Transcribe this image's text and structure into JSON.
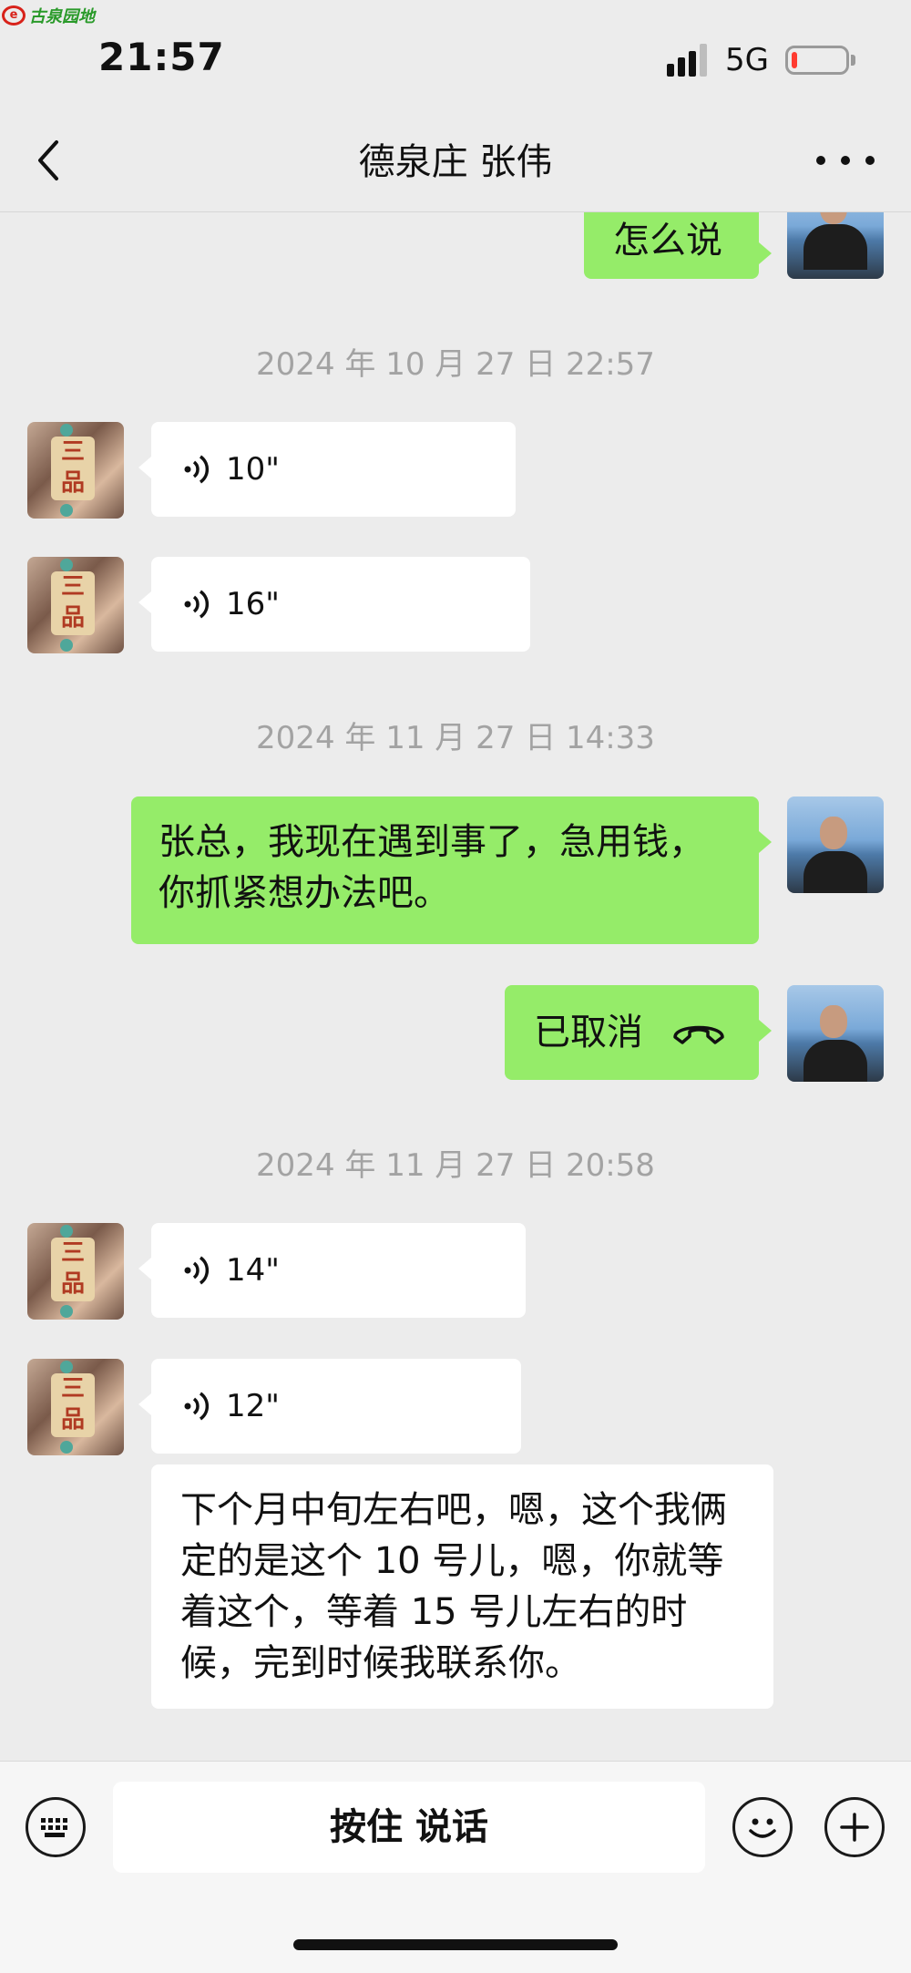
{
  "watermark": {
    "text": "古泉园地"
  },
  "status": {
    "time": "21:57",
    "network": "5G"
  },
  "header": {
    "title": "德泉庄  张伟"
  },
  "messages": {
    "partial_sent": "怎么说",
    "ts1": "2024 年 10 月 27 日 22:57",
    "voice1": "10\"",
    "voice2": "16\"",
    "ts2": "2024 年 11 月 27 日 14:33",
    "sent_text": "张总，我现在遇到事了，急用钱，你抓紧想办法吧。",
    "call": "已取消",
    "ts3": "2024 年 11 月 27 日 20:58",
    "voice3": "14\"",
    "voice4": "12\"",
    "transcript": "下个月中旬左右吧，嗯，这个我俩定的是这个 10 号儿，嗯，你就等着这个，等着 15 号儿左右的时候，完到时候我联系你。"
  },
  "avatars": {
    "other_tile": "三品"
  },
  "input": {
    "hold_talk": "按住 说话"
  },
  "icons": {
    "back": "chevron-left-icon",
    "more": "more-icon",
    "voice": "sound-wave-icon",
    "hangup": "hangup-icon",
    "keyboard": "keyboard-icon",
    "emoji": "emoji-icon",
    "plus": "plus-icon"
  },
  "colors": {
    "sent_bubble": "#95ec69",
    "received_bubble": "#ffffff",
    "background": "#ececec",
    "battery_low": "#ff3b30"
  }
}
